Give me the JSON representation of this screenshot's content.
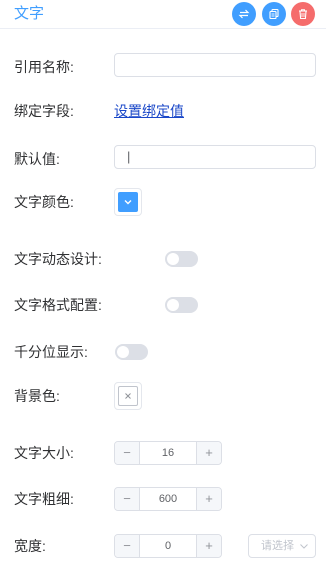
{
  "header": {
    "title": "文字",
    "actions": [
      {
        "name": "swap",
        "icon": "swap-arrows-icon",
        "color": "#409eff"
      },
      {
        "name": "copy",
        "icon": "copy-icon",
        "color": "#409eff"
      },
      {
        "name": "delete",
        "icon": "trash-icon",
        "color": "#f56c6c"
      }
    ]
  },
  "form": {
    "ref_name": {
      "label": "引用名称:",
      "value": ""
    },
    "bind_field": {
      "label": "绑定字段:",
      "link": "设置绑定值"
    },
    "default_value": {
      "label": "默认值:",
      "value": "|"
    },
    "text_color": {
      "label": "文字颜色:",
      "color": "#409eff",
      "icon": "chevron-down-icon"
    },
    "dynamic_design": {
      "label": "文字动态设计:",
      "enabled": false
    },
    "format_config": {
      "label": "文字格式配置:",
      "enabled": false
    },
    "thousands": {
      "label": "千分位显示:",
      "enabled": false
    },
    "background": {
      "label": "背景色:",
      "icon": "close-icon"
    },
    "font_size": {
      "label": "文字大小:",
      "value": "16",
      "minus": "−",
      "plus": "+"
    },
    "font_weight": {
      "label": "文字粗细:",
      "value": "600",
      "minus": "−",
      "plus": "+"
    },
    "width": {
      "label": "宽度:",
      "value": "0",
      "minus": "−",
      "plus": "+",
      "unit_placeholder": "请选择"
    }
  },
  "colors": {
    "accent": "#409eff",
    "danger": "#f56c6c",
    "link": "#1a47c8",
    "switch_off": "#dcdfe6"
  }
}
